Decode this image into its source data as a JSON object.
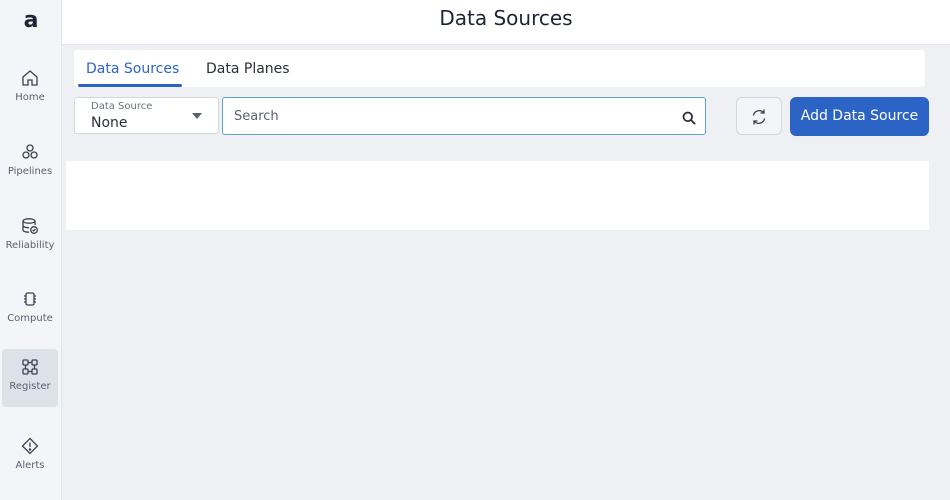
{
  "app": {
    "logo_text": "a"
  },
  "sidebar": {
    "items": [
      {
        "label": "Home",
        "icon": "home-icon",
        "active": false
      },
      {
        "label": "Pipelines",
        "icon": "pipelines-icon",
        "active": false
      },
      {
        "label": "Reliability",
        "icon": "reliability-icon",
        "active": false
      },
      {
        "label": "Compute",
        "icon": "compute-icon",
        "active": false
      },
      {
        "label": "Register",
        "icon": "register-icon",
        "active": true
      },
      {
        "label": "Alerts",
        "icon": "alert-icon",
        "active": false
      }
    ]
  },
  "header": {
    "title": "Data Sources"
  },
  "tabs": [
    {
      "label": "Data Sources",
      "active": true
    },
    {
      "label": "Data Planes",
      "active": false
    }
  ],
  "filters": {
    "data_source_label": "Data Source",
    "data_source_value": "None",
    "search_placeholder": "Search",
    "search_value": ""
  },
  "actions": {
    "refresh_icon": "refresh-icon",
    "add_label": "Add Data Source"
  },
  "colors": {
    "accent": "#2c64c6",
    "background": "#eef0f4",
    "search_border": "#5aa6c8"
  }
}
